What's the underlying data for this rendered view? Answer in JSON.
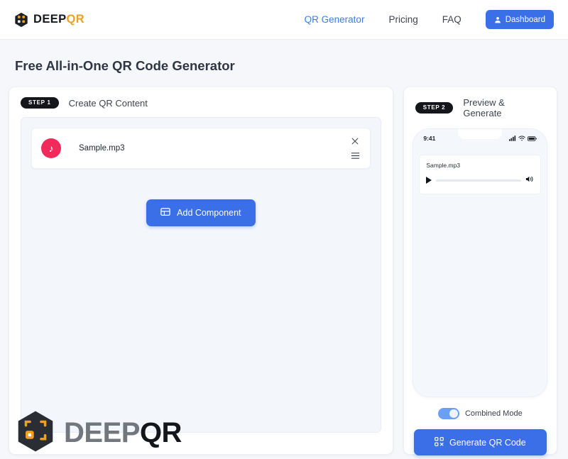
{
  "brand": {
    "deep": "DEEP",
    "qr": "QR",
    "icon": "hexagon-qr-logo"
  },
  "nav": {
    "links": [
      {
        "label": "QR Generator",
        "active": true
      },
      {
        "label": "Pricing",
        "active": false
      },
      {
        "label": "FAQ",
        "active": false
      }
    ],
    "dashboard_label": "Dashboard",
    "dashboard_icon": "user-icon",
    "accent_color": "#3b6fe8",
    "active_link_color": "#3b7cf6"
  },
  "page": {
    "title": "Free All-in-One QR Code Generator"
  },
  "left_panel": {
    "step_badge": "STEP 1",
    "title": "Create QR Content",
    "component": {
      "icon": "music-note-icon",
      "icon_color": "#f2295b",
      "label": "Sample.mp3",
      "close_icon": "close-icon",
      "drag_icon": "drag-handle-icon"
    },
    "add_button": {
      "label": "Add Component",
      "icon": "add-component-icon"
    }
  },
  "right_panel": {
    "step_badge": "STEP 2",
    "title": "Preview & Generate",
    "phone": {
      "clock": "9:41",
      "status_icons": [
        "signal-icon",
        "wifi-icon",
        "battery-icon"
      ],
      "audio": {
        "title": "Sample.mp3",
        "play_icon": "play-icon",
        "volume_icon": "volume-icon",
        "progress_percent": 0
      }
    },
    "toggle": {
      "label": "Combined Mode",
      "enabled": true,
      "color": "#6b9ff5"
    },
    "generate_button": {
      "label": "Generate QR Code",
      "icon": "qr-code-icon"
    }
  },
  "watermark": {
    "deep": "DEEP",
    "qr": "QR",
    "icon": "hexagon-qr-logo"
  }
}
